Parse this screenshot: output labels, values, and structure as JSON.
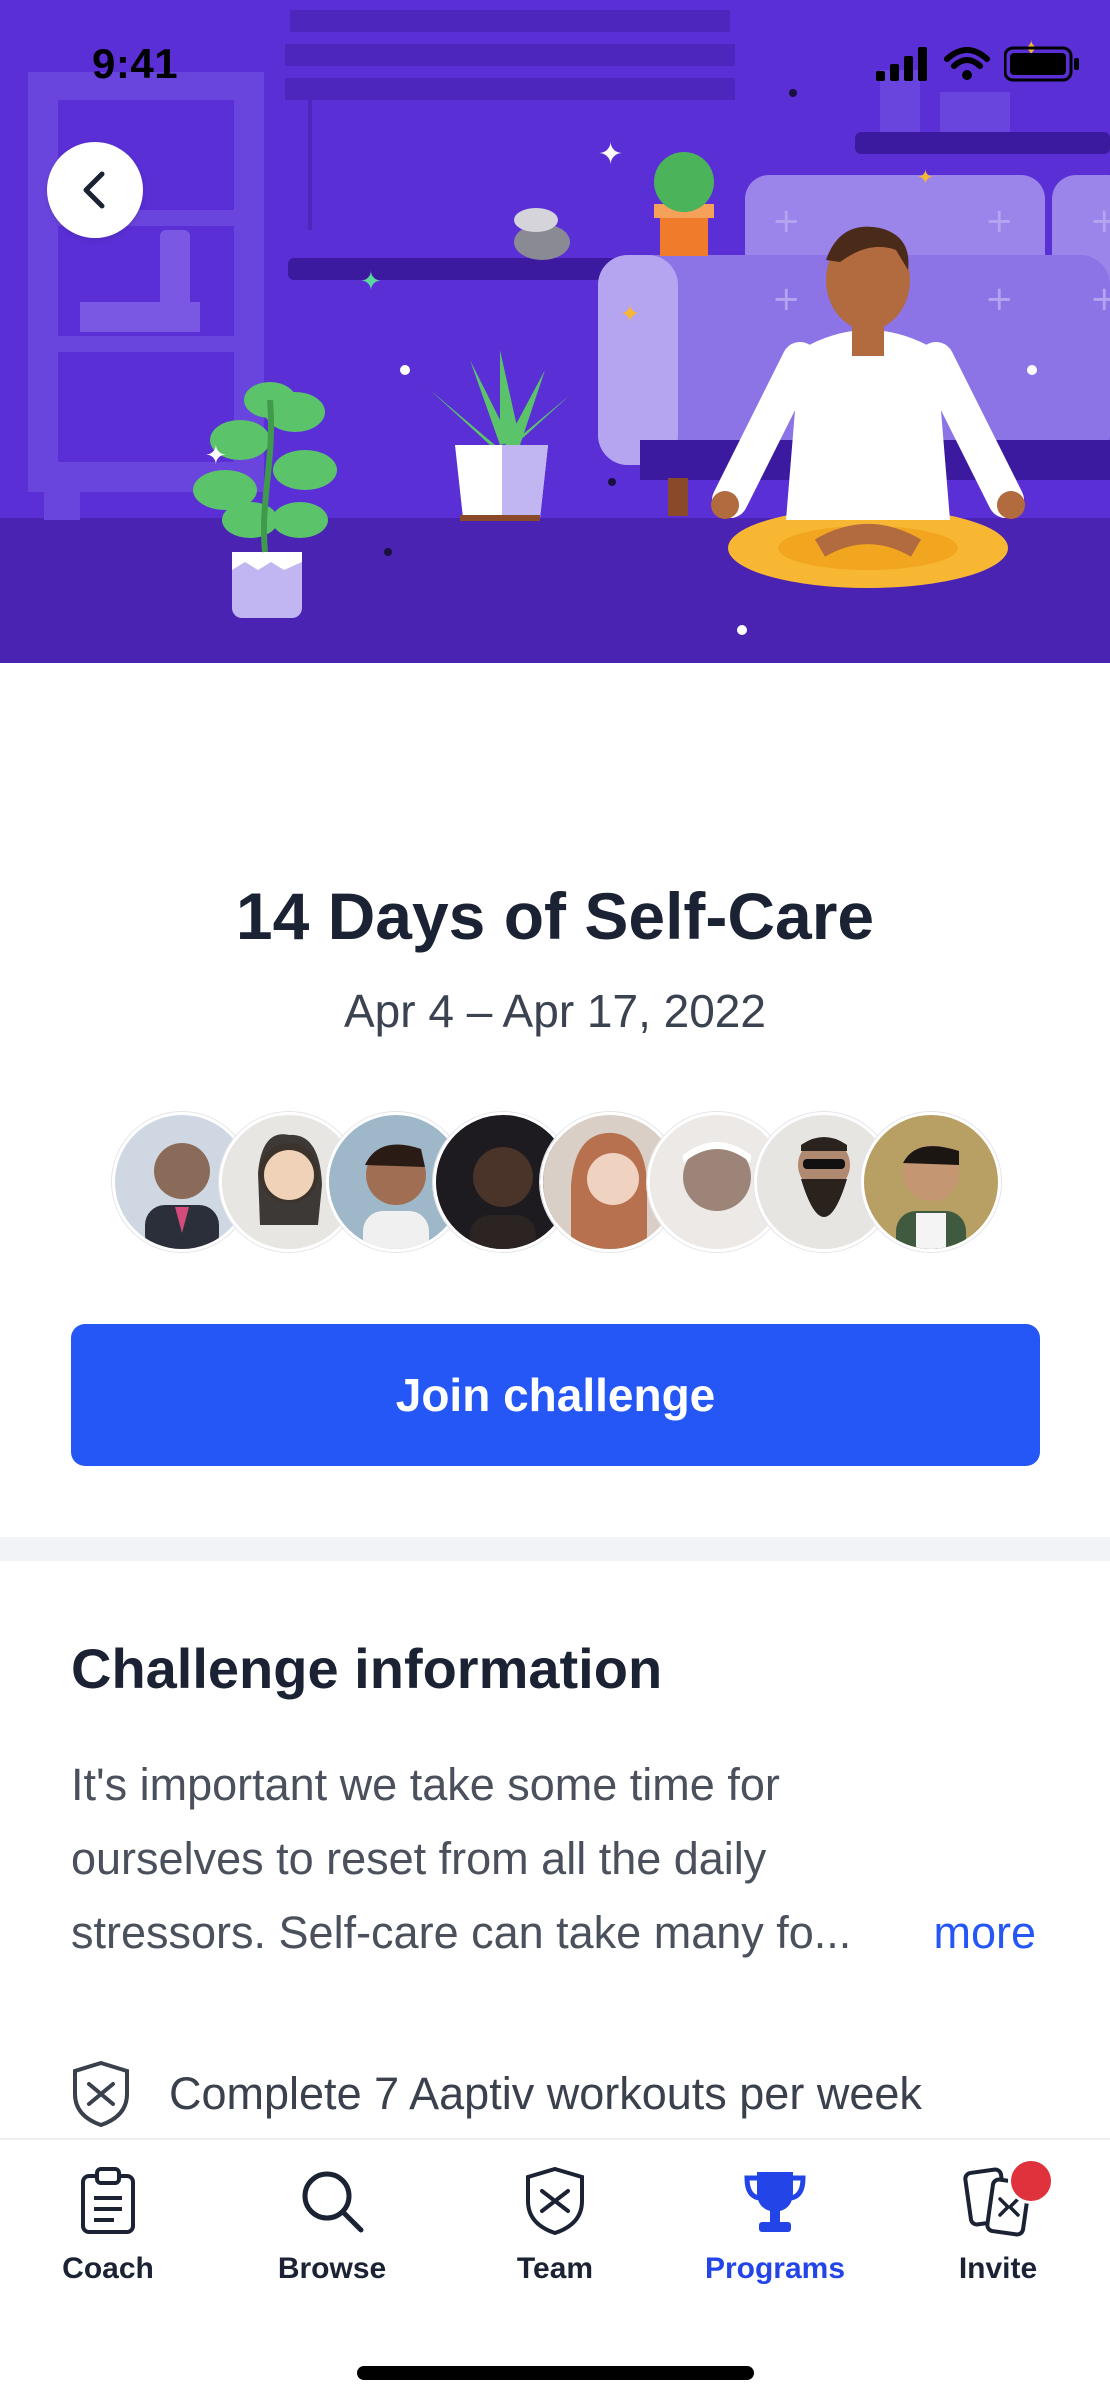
{
  "status_bar": {
    "time": "9:41"
  },
  "hero": {
    "illustration": "meditation-room-illustration"
  },
  "nav": {
    "back_icon": "chevron-left-icon"
  },
  "program": {
    "title": "14 Days of Self-Care",
    "dates": "Apr 4 – Apr 17, 2022",
    "participants": [
      {
        "name": "participant-1",
        "bg": "#8a6a58"
      },
      {
        "name": "participant-2",
        "bg": "#d9c2b0"
      },
      {
        "name": "participant-3",
        "bg": "#6b5246"
      },
      {
        "name": "participant-4",
        "bg": "#2b2422"
      },
      {
        "name": "participant-5",
        "bg": "#b7714f"
      },
      {
        "name": "participant-6",
        "bg": "#9c8478"
      },
      {
        "name": "participant-7",
        "bg": "#3e3a38"
      },
      {
        "name": "participant-8",
        "bg": "#7a6a40"
      }
    ],
    "join_label": "Join challenge"
  },
  "info": {
    "heading": "Challenge information",
    "lines": [
      "It's important we take some time for",
      "ourselves to reset from all the daily",
      "stressors. Self-care can take many fo..."
    ],
    "more_label": "more",
    "requirement": "Complete 7 Aaptiv workouts per week"
  },
  "tabbar": {
    "tabs": [
      {
        "label": "Coach",
        "icon": "clipboard-icon",
        "active": false
      },
      {
        "label": "Browse",
        "icon": "search-icon",
        "active": false
      },
      {
        "label": "Team",
        "icon": "shield-icon",
        "active": false
      },
      {
        "label": "Programs",
        "icon": "trophy-icon",
        "active": true
      },
      {
        "label": "Invite",
        "icon": "invite-cards-icon",
        "active": false
      }
    ]
  },
  "colors": {
    "accent": "#2457f5",
    "hero_bg": "#5a2fd6",
    "badge": "#e0323c"
  }
}
